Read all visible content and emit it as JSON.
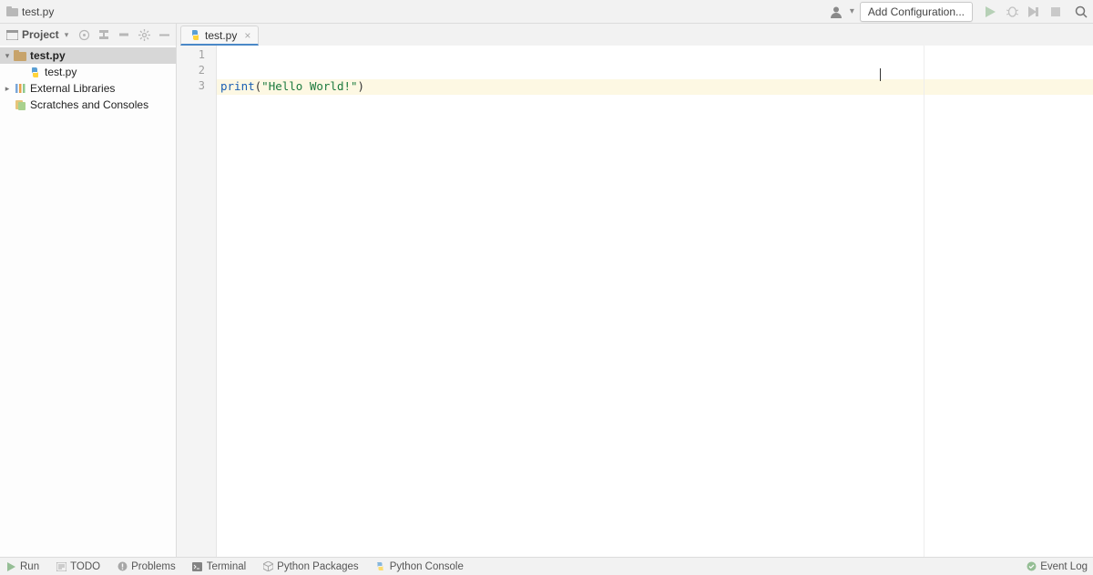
{
  "breadcrumb": {
    "project": "test.py"
  },
  "toolbar": {
    "add_configuration_label": "Add Configuration..."
  },
  "project_panel": {
    "title": "Project",
    "tree": {
      "root": "test.py",
      "root_file": "test.py",
      "external_libraries": "External Libraries",
      "scratches": "Scratches and Consoles"
    }
  },
  "tabs": {
    "active": "test.py"
  },
  "editor": {
    "lines": {
      "l1": "1",
      "l2": "2",
      "l3": "3"
    },
    "code": {
      "fn": "print",
      "open": "(",
      "string": "\"Hello World!\"",
      "close": ")"
    }
  },
  "bottom": {
    "run": "Run",
    "todo": "TODO",
    "problems": "Problems",
    "terminal": "Terminal",
    "python_packages": "Python Packages",
    "python_console": "Python Console",
    "event_log": "Event Log"
  }
}
